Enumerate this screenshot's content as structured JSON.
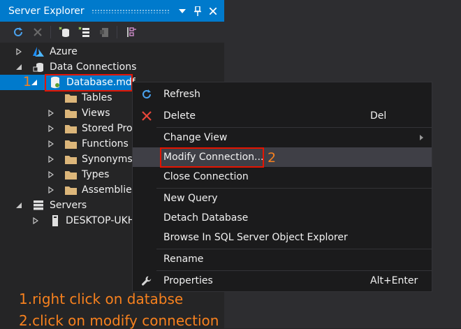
{
  "window": {
    "title": "Server Explorer"
  },
  "tree": {
    "azure": "Azure",
    "data_connections": "Data Connections",
    "database": "Database.mdf",
    "tables": "Tables",
    "views": "Views",
    "stored_procs": "Stored Proc",
    "functions": "Functions",
    "synonyms": "Synonyms",
    "types": "Types",
    "assemblies": "Assemblies",
    "servers": "Servers",
    "desktop": "DESKTOP-UKH"
  },
  "menu": {
    "refresh": "Refresh",
    "delete": "Delete",
    "delete_shortcut": "Del",
    "change_view": "Change View",
    "modify_connection": "Modify Connection...",
    "close_connection": "Close Connection",
    "new_query": "New Query",
    "detach_database": "Detach Database",
    "browse_sql": "Browse In SQL Server Object Explorer",
    "rename": "Rename",
    "properties": "Properties",
    "properties_shortcut": "Alt+Enter"
  },
  "annotations": {
    "step1_marker": "1",
    "step2_marker": "2",
    "instruction1": "1.right click on databse",
    "instruction2": "2.click on modify connection"
  },
  "colors": {
    "accent": "#007acc",
    "annotation": "#f7811e",
    "highlight_box": "#e51400",
    "folder": "#dcb67a"
  }
}
